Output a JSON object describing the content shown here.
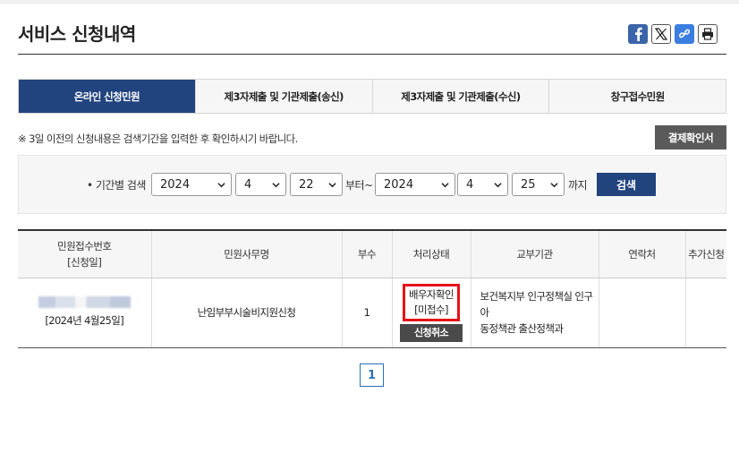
{
  "page": {
    "title": "서비스 신청내역"
  },
  "share_icons": [
    "facebook-icon",
    "x-icon",
    "link-icon",
    "print-icon"
  ],
  "tabs": [
    {
      "label": "온라인 신청민원",
      "active": true
    },
    {
      "label": "제3자제출 및 기관제출(송신)",
      "active": false
    },
    {
      "label": "제3자제출 및 기관제출(수신)",
      "active": false
    },
    {
      "label": "창구접수민원",
      "active": false
    }
  ],
  "notice": "※ 3일 이전의 신청내용은 검색기간을 입력한 후 확인하시기 바랍니다.",
  "payment_button": "결제확인서",
  "search": {
    "label": "• 기간별 검색",
    "from": {
      "year": "2024",
      "month": "4",
      "day": "22"
    },
    "from_suffix": "부터~",
    "to": {
      "year": "2024",
      "month": "4",
      "day": "25"
    },
    "to_suffix": "까지",
    "button": "검색"
  },
  "table": {
    "headers": {
      "receipt_no_line1": "민원접수번호",
      "receipt_no_line2": "[신청일]",
      "task_name": "민원사무명",
      "copies": "부수",
      "status": "처리상태",
      "issuer": "교부기관",
      "contact": "연락처",
      "extra": "추가신청"
    },
    "rows": [
      {
        "date": "[2024년 4월25일]",
        "task_name": "난임부부시술비지원신청",
        "copies": "1",
        "status_line1": "배우자확인",
        "status_line2": "[미접수]",
        "cancel_label": "신청취소",
        "issuer_line1": "보건복지부 인구정책실 인구아",
        "issuer_line2": "동정책관 출산정책과",
        "contact": "",
        "extra": ""
      }
    ]
  },
  "pagination": {
    "current_page": "1"
  }
}
